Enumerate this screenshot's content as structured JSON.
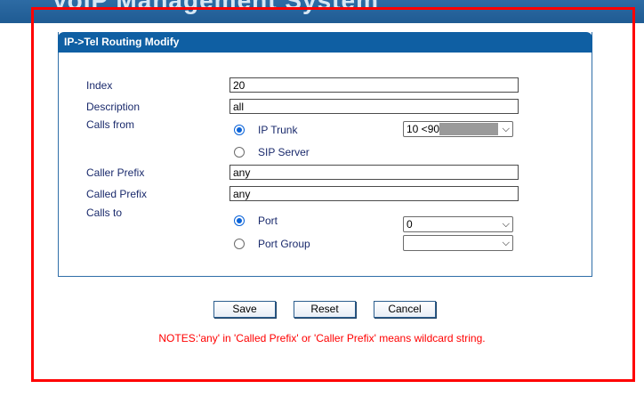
{
  "header": {
    "system_title": "VoIP Management System"
  },
  "panel": {
    "title": "IP->Tel Routing Modify"
  },
  "form": {
    "index": {
      "label": "Index",
      "value": "20"
    },
    "description": {
      "label": "Description",
      "value": "all"
    },
    "calls_from": {
      "label": "Calls from",
      "ip_trunk": {
        "label": "IP Trunk",
        "selected": true,
        "select_value": "10 <90"
      },
      "sip_server": {
        "label": "SIP Server",
        "selected": false
      }
    },
    "caller_prefix": {
      "label": "Caller Prefix",
      "value": "any"
    },
    "called_prefix": {
      "label": "Called Prefix",
      "value": "any"
    },
    "calls_to": {
      "label": "Calls to",
      "port": {
        "label": "Port",
        "selected": true,
        "select_value": "0"
      },
      "port_group": {
        "label": "Port Group",
        "selected": false,
        "select_value": ""
      }
    }
  },
  "buttons": {
    "save": "Save",
    "reset": "Reset",
    "cancel": "Cancel"
  },
  "notes": "NOTES:'any' in 'Called Prefix' or 'Caller Prefix' means wildcard string.",
  "colors": {
    "header_blue": "#0f5fa3",
    "highlight_red": "#ff0000",
    "note_red": "#ff0000"
  },
  "icons": {
    "dropdown": "chevron-down-icon"
  }
}
